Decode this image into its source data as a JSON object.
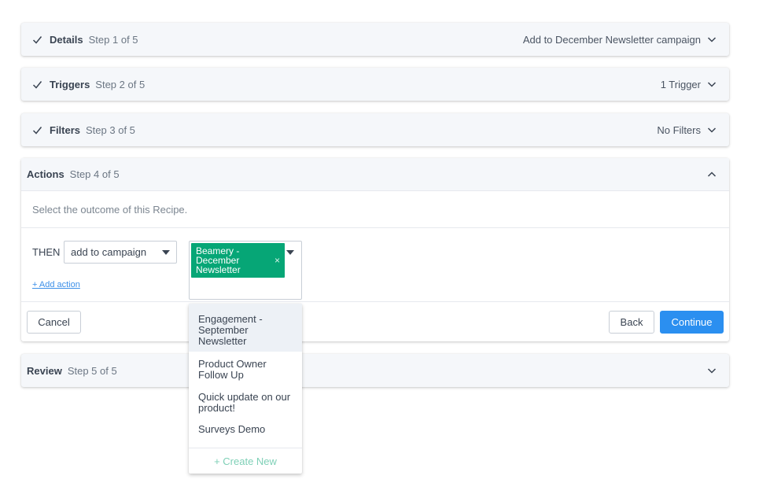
{
  "steps": {
    "details": {
      "title": "Details",
      "sub": "Step 1 of 5",
      "summary": "Add to December Newsletter campaign"
    },
    "triggers": {
      "title": "Triggers",
      "sub": "Step 2 of 5",
      "summary": "1 Trigger"
    },
    "filters": {
      "title": "Filters",
      "sub": "Step 3 of 5",
      "summary": "No Filters"
    },
    "actions": {
      "title": "Actions",
      "sub": "Step 4 of 5"
    },
    "review": {
      "title": "Review",
      "sub": "Step 5 of 5"
    }
  },
  "actions": {
    "description": "Select the outcome of this Recipe.",
    "then_label": "THEN",
    "action_select": "add to campaign",
    "selected_tag": "Beamery - December Newsletter",
    "tag_remove": "×",
    "add_action": "+ Add action",
    "cancel": "Cancel",
    "back": "Back",
    "continue": "Continue"
  },
  "dropdown": {
    "options": [
      "Engagement - September Newsletter",
      "Product Owner Follow Up",
      "Quick update on our product!",
      "Surveys Demo"
    ],
    "create_new": "+ Create New"
  },
  "colors": {
    "accent": "#2b8ff0",
    "tag": "#06a676",
    "link": "#3b8fe8",
    "create": "#7fd0b7"
  }
}
